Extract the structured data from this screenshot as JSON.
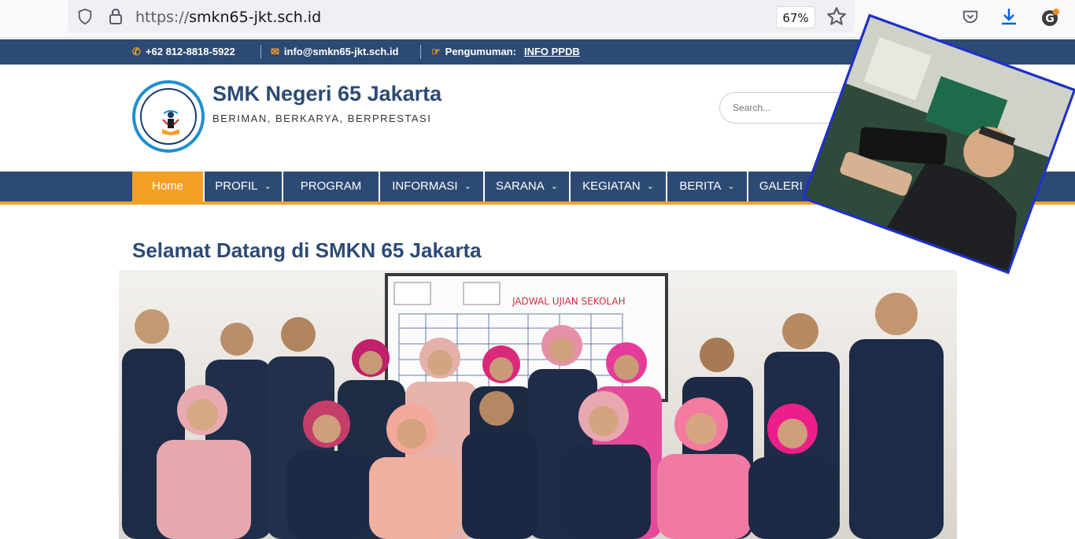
{
  "browser": {
    "url_prefix": "https://",
    "url_host": "smkn65-jkt.sch.id",
    "zoom": "67%"
  },
  "topbar": {
    "phone": "+62 812-8818-5922",
    "email": "info@smkn65-jkt.sch.id",
    "announcement_label": "Pengumuman:",
    "announcement_link": "INFO PPDB"
  },
  "header": {
    "logo_text": "SMK NEGERI 65 JAKARTA",
    "title": "SMK Negeri 65 Jakarta",
    "tagline": "BERIMAN, BERKARYA, BERPRESTASI",
    "search_placeholder": "Search..."
  },
  "nav": {
    "items": [
      {
        "label": "Home",
        "active": true,
        "dropdown": false
      },
      {
        "label": "PROFIL",
        "active": false,
        "dropdown": true
      },
      {
        "label": "PROGRAM",
        "active": false,
        "dropdown": false
      },
      {
        "label": "INFORMASI",
        "active": false,
        "dropdown": true
      },
      {
        "label": "SARANA",
        "active": false,
        "dropdown": true
      },
      {
        "label": "KEGIATAN",
        "active": false,
        "dropdown": true
      },
      {
        "label": "BERITA",
        "active": false,
        "dropdown": true
      },
      {
        "label": "GALERI",
        "active": false,
        "dropdown": true
      }
    ]
  },
  "main": {
    "welcome": "Selamat Datang di SMKN 65 Jakarta",
    "whiteboard_title": "JADWAL UJIAN SEKOLAH"
  },
  "colors": {
    "primary": "#2c4a74",
    "accent": "#f4a024",
    "inset_border": "#1f2fd0"
  }
}
